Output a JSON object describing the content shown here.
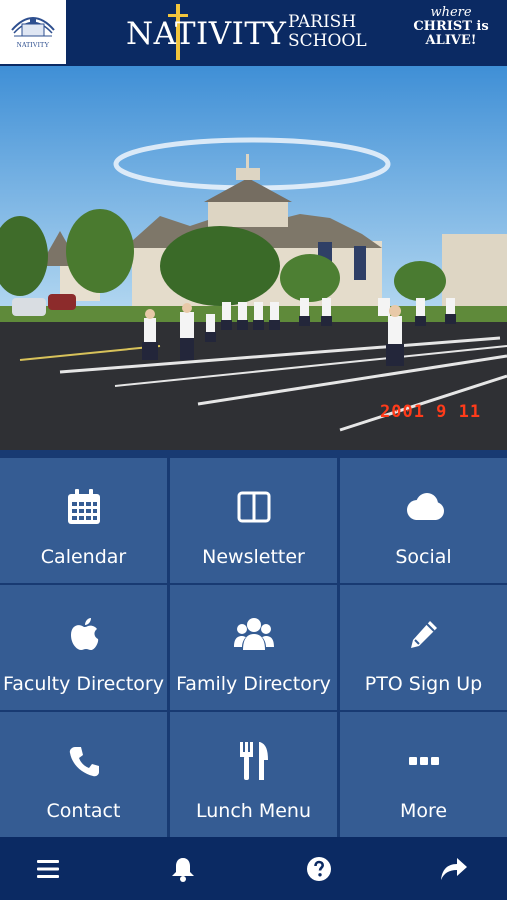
{
  "header": {
    "logo_text": "NATIVITY",
    "brand_main": "NATIVITY",
    "brand_parish": "PARISH",
    "brand_school": "SCHOOL",
    "tagline_line1": "where",
    "tagline_line2": "CHRIST is",
    "tagline_line3": "ALIVE!"
  },
  "photo": {
    "date_stamp": "2001  9 11"
  },
  "tiles": [
    {
      "label": "Calendar",
      "icon": "calendar-icon"
    },
    {
      "label": "Newsletter",
      "icon": "newsletter-icon"
    },
    {
      "label": "Social",
      "icon": "cloud-icon"
    },
    {
      "label": "Faculty Directory",
      "icon": "apple-icon"
    },
    {
      "label": "Family Directory",
      "icon": "group-icon"
    },
    {
      "label": "PTO Sign Up",
      "icon": "pencil-icon"
    },
    {
      "label": "Contact",
      "icon": "phone-icon"
    },
    {
      "label": "Lunch Menu",
      "icon": "utensils-icon"
    },
    {
      "label": "More",
      "icon": "ellipsis-icon"
    }
  ],
  "bottom_nav": [
    "menu-icon",
    "bell-icon",
    "help-icon",
    "share-icon"
  ],
  "colors": {
    "header_bg": "#0b2a63",
    "tile_bg": "#355c93",
    "grid_gap": "#183a72",
    "accent_gold": "#f2c53d",
    "stamp_red": "#ff3b1a"
  }
}
